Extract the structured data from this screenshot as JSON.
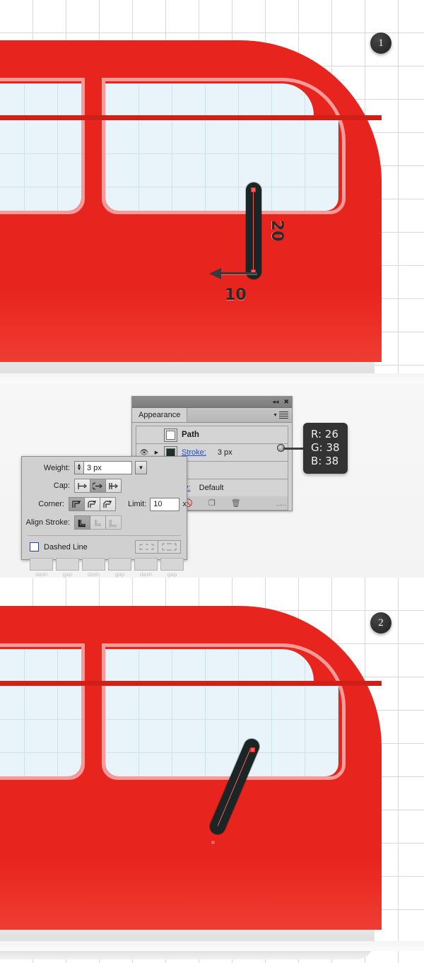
{
  "steps": [
    {
      "number": "1"
    },
    {
      "number": "2"
    }
  ],
  "illustration_1": {
    "name": "bus-front-with-vertical-stroke",
    "measure_vertical_label": "20",
    "measure_horizontal_label": "10",
    "stroke_color": "#1a2626",
    "body_color": "#e8241e",
    "glass_color": "#e8f4fa"
  },
  "illustration_2": {
    "name": "bus-front-with-diagonal-stroke",
    "stroke_color": "#1a2626",
    "body_color": "#e8241e",
    "glass_color": "#e8f4fa"
  },
  "appearance_panel": {
    "titlebar": {
      "collapse_icon": "collapse-double-arrow",
      "close_icon": "close-x"
    },
    "tab_label": "Appearance",
    "menu_icon": "panel-menu",
    "rows": [
      {
        "label": "Path",
        "swatch": "white-fill-swatch"
      },
      {
        "label": "Stroke:",
        "value": "3 px",
        "swatch": "dark-stroke-swatch",
        "eye_icon": "eye-visibility-icon",
        "disclosure_icon": "disclosure-triangle"
      },
      {
        "label": "",
        "value": "",
        "swatch": "none-fill-swatch"
      },
      {
        "label": "ty:",
        "value": "Default"
      }
    ],
    "footer_icons": [
      "no-appearance-icon",
      "duplicate-item-icon",
      "delete-item-icon"
    ],
    "resize_grip": "resize-grip"
  },
  "rgb_tooltip": {
    "r": "R: 26",
    "g": "G: 38",
    "b": "B: 38"
  },
  "stroke_popup": {
    "weight": {
      "label": "Weight:",
      "value": "3 px"
    },
    "cap": {
      "label": "Cap:",
      "options": [
        "butt-cap",
        "round-cap",
        "projecting-cap"
      ],
      "selected_index": 1
    },
    "corner": {
      "label": "Corner:",
      "options": [
        "miter-join",
        "round-join",
        "bevel-join"
      ],
      "selected_index": 0
    },
    "limit": {
      "label": "Limit:",
      "value": "10",
      "unit": "x"
    },
    "align_stroke": {
      "label": "Align Stroke:",
      "options": [
        "align-center",
        "align-inside",
        "align-outside"
      ],
      "selected_index": 0
    },
    "dashed_line": {
      "label": "Dashed Line",
      "checked": false,
      "preserve_icons": [
        "preserve-exact-dash",
        "adjust-dashes-to-corners"
      ]
    },
    "dash_fields": [
      "",
      "",
      "",
      "",
      "",
      ""
    ],
    "dash_captions": [
      "dash",
      "gap",
      "dash",
      "gap",
      "dash",
      "gap"
    ]
  }
}
